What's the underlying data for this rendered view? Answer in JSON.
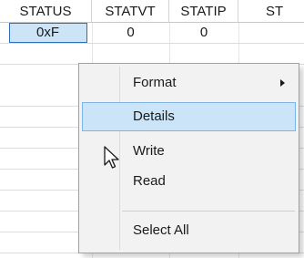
{
  "grid": {
    "columns": [
      {
        "label": "STATUS"
      },
      {
        "label": "STATVT"
      },
      {
        "label": "STATIP"
      },
      {
        "label": "ST"
      }
    ],
    "rows": [
      {
        "status": "0xF",
        "statvt": "0",
        "statip": "0"
      }
    ],
    "partial_text": ">"
  },
  "context_menu": {
    "items": [
      {
        "label": "Format",
        "has_submenu": true
      },
      {
        "label": "Details",
        "highlighted": true
      },
      {
        "label": "Write"
      },
      {
        "label": "Read"
      },
      {
        "label": "Select All"
      }
    ],
    "submenu_arrow_icon": "chevron-right-icon"
  },
  "cursor_icon": "arrow-pointer-icon",
  "colors": {
    "selection_fill": "#cde4f7",
    "selection_border": "#2b6fb8",
    "menu_background": "#f2f2f2",
    "menu_highlight": "#cce4f7",
    "menu_highlight_border": "#7eb4ea"
  }
}
